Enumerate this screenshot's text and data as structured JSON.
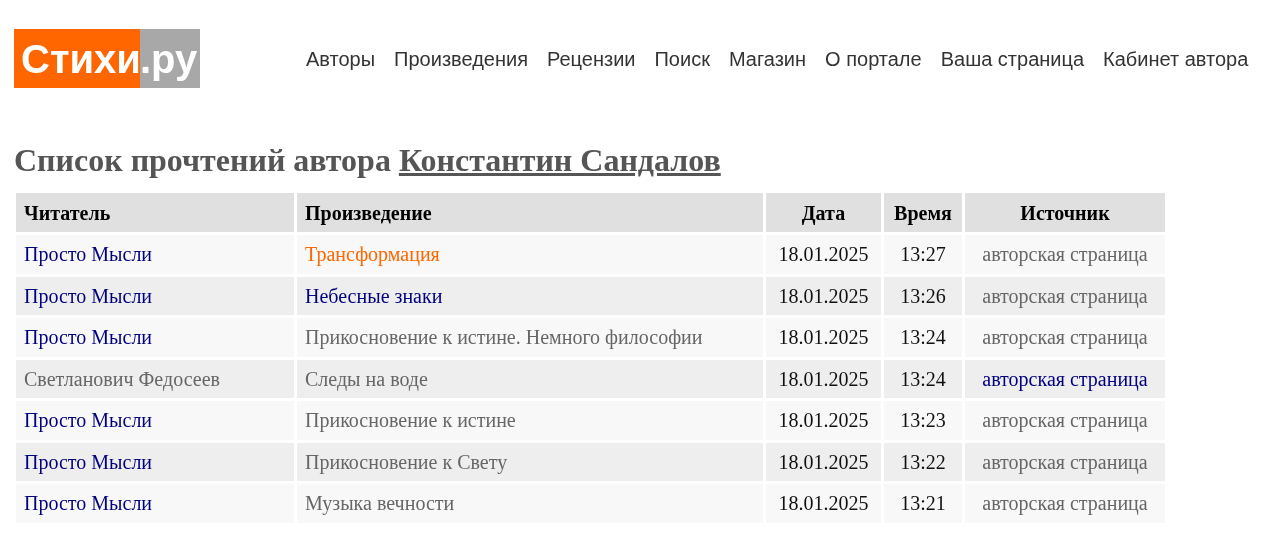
{
  "logo": {
    "main": "Стихи",
    "suffix": ".ру"
  },
  "nav": [
    "Авторы",
    "Произведения",
    "Рецензии",
    "Поиск",
    "Магазин",
    "О портале",
    "Ваша страница",
    "Кабинет автора"
  ],
  "heading": {
    "text": "Список прочтений автора",
    "author": "Константин Сандалов"
  },
  "table": {
    "columns": [
      {
        "label": "Читатель"
      },
      {
        "label": "Произведение"
      },
      {
        "label": "Дата"
      },
      {
        "label": "Время"
      },
      {
        "label": "Источник"
      }
    ],
    "rows": [
      {
        "reader": {
          "text": "Просто Мысли",
          "kind": "link"
        },
        "work": {
          "text": "Трансформация",
          "kind": "active"
        },
        "date": "18.01.2025",
        "time": "13:27",
        "source": {
          "text": "авторская страница",
          "kind": "visited"
        }
      },
      {
        "reader": {
          "text": "Просто Мысли",
          "kind": "link"
        },
        "work": {
          "text": "Небесные знаки",
          "kind": "link"
        },
        "date": "18.01.2025",
        "time": "13:26",
        "source": {
          "text": "авторская страница",
          "kind": "visited"
        }
      },
      {
        "reader": {
          "text": "Просто Мысли",
          "kind": "link"
        },
        "work": {
          "text": "Прикосновение к истине. Немного философии",
          "kind": "visited"
        },
        "date": "18.01.2025",
        "time": "13:24",
        "source": {
          "text": "авторская страница",
          "kind": "visited"
        }
      },
      {
        "reader": {
          "text": "Светланович Федосеев",
          "kind": "visited"
        },
        "work": {
          "text": "Следы на воде",
          "kind": "visited"
        },
        "date": "18.01.2025",
        "time": "13:24",
        "source": {
          "text": "авторская страница",
          "kind": "link"
        }
      },
      {
        "reader": {
          "text": "Просто Мысли",
          "kind": "link"
        },
        "work": {
          "text": "Прикосновение к истине",
          "kind": "visited"
        },
        "date": "18.01.2025",
        "time": "13:23",
        "source": {
          "text": "авторская страница",
          "kind": "visited"
        }
      },
      {
        "reader": {
          "text": "Просто Мысли",
          "kind": "link"
        },
        "work": {
          "text": "Прикосновение к Свету",
          "kind": "visited"
        },
        "date": "18.01.2025",
        "time": "13:22",
        "source": {
          "text": "авторская страница",
          "kind": "visited"
        }
      },
      {
        "reader": {
          "text": "Просто Мысли",
          "kind": "link"
        },
        "work": {
          "text": "Музыка вечности",
          "kind": "visited"
        },
        "date": "18.01.2025",
        "time": "13:21",
        "source": {
          "text": "авторская страница",
          "kind": "visited"
        }
      }
    ]
  }
}
